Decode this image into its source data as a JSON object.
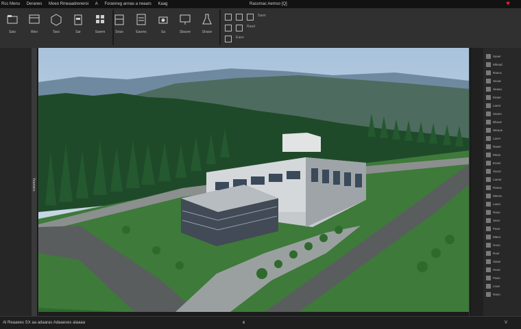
{
  "titlebar": {
    "items": [
      "Rcc Menu",
      "Deranes",
      "Moeo Rmeaadreneroi",
      "A",
      "Foranneg annas a rwaars",
      "Kaag"
    ],
    "center": "Rassmac Aemso [Q]"
  },
  "ribbon": {
    "group1": [
      {
        "label": "Saio",
        "icon": "folder-icon"
      },
      {
        "label": "Weo",
        "icon": "window-icon"
      },
      {
        "label": "Taoc",
        "icon": "cube-icon"
      },
      {
        "label": "Sar",
        "icon": "tool-icon"
      },
      {
        "label": "Sarem",
        "icon": "grid-icon"
      }
    ],
    "group2": [
      {
        "label": "Sirao",
        "icon": "building-icon"
      },
      {
        "label": "Eaoms",
        "icon": "document-icon"
      },
      {
        "label": "Sa",
        "icon": "camera-icon"
      },
      {
        "label": "Sbaore",
        "icon": "monitor-icon"
      },
      {
        "label": "Shaoe",
        "icon": "flask-icon"
      }
    ],
    "panel_text": [
      "Saon",
      "Raod",
      "Eaoo"
    ]
  },
  "left_panel": {
    "strip_text": "Yeamers"
  },
  "right_panel": {
    "rows": [
      "Saver",
      "Mhead",
      "Raeoc",
      "Seuar",
      "Seaao",
      "Eeaer",
      "Laeor",
      "Saoes",
      "Bhaoe",
      "Weaoe",
      "Laver",
      "Raser",
      "Mnao",
      "Eoser",
      "Saoor",
      "Laeoe",
      "Rasoo",
      "Meeoc",
      "Laeio",
      "Raoe",
      "Seen",
      "Paoe",
      "Maeo",
      "Hono",
      "Roer",
      "Sawe",
      "Heoe",
      "Paeo",
      "Lnoe",
      "Raeo"
    ]
  },
  "statusbar": {
    "left": "Al Reaaees  SX  aa adaaras  Adaaeses  alaaaa",
    "mid": "c",
    "right": "V"
  },
  "viewport": {
    "scene": "3D rendered building"
  }
}
